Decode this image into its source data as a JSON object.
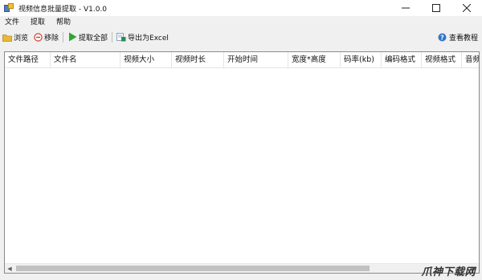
{
  "window": {
    "title": "视频信息批量提取 - V1.0.0"
  },
  "menu": {
    "items": [
      "文件",
      "提取",
      "帮助"
    ]
  },
  "toolbar": {
    "browse_label": "浏览",
    "remove_label": "移除",
    "extract_all_label": "提取全部",
    "export_label": "导出为Excel",
    "tutorial_label": "查看教程"
  },
  "table": {
    "columns": [
      "文件路径",
      "文件名",
      "视频大小",
      "视频时长",
      "开始时间",
      "宽度*高度",
      "码率(kb)",
      "编码格式",
      "视频格式",
      "音频"
    ]
  },
  "watermark": "爪神下载网",
  "colors": {
    "play_green": "#2fa52f",
    "help_blue": "#2f74c9",
    "remove_red": "#d23c2c",
    "folder_yellow": "#e8b83a"
  }
}
